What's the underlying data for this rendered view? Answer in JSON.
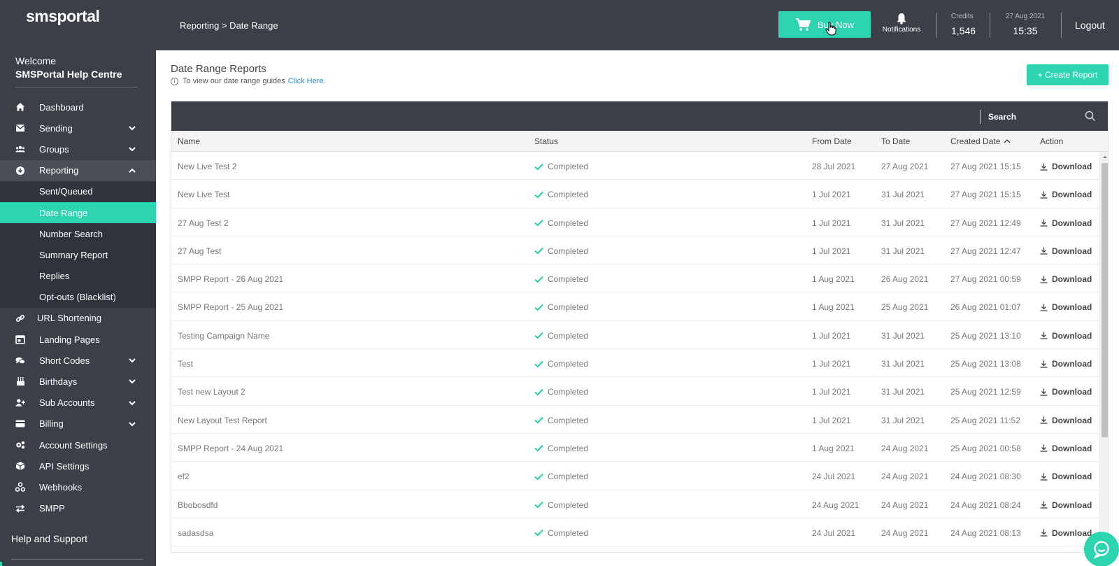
{
  "brand": {
    "logo_text": "smsportal",
    "accent": "#2cd4b0"
  },
  "sidebar": {
    "welcome": "Welcome",
    "org_name": "SMSPortal Help Centre",
    "items": [
      {
        "label": "Dashboard",
        "icon": "home-icon",
        "chevron": false
      },
      {
        "label": "Sending",
        "icon": "envelope-icon",
        "chevron": true
      },
      {
        "label": "Groups",
        "icon": "users-icon",
        "chevron": true
      },
      {
        "label": "Reporting",
        "icon": "download-circle-icon",
        "chevron": true,
        "expanded": true
      }
    ],
    "reporting_sub": [
      {
        "label": "Sent/Queued"
      },
      {
        "label": "Date Range",
        "selected": true
      },
      {
        "label": "Number Search"
      },
      {
        "label": "Summary Report"
      },
      {
        "label": "Replies"
      },
      {
        "label": "Opt-outs (Blacklist)"
      }
    ],
    "items_after": [
      {
        "label": "URL Shortening",
        "icon": "link-icon",
        "chevron": false
      },
      {
        "label": "Landing Pages",
        "icon": "page-icon",
        "chevron": false
      },
      {
        "label": "Short Codes",
        "icon": "chat-bubbles-icon",
        "chevron": true
      },
      {
        "label": "Birthdays",
        "icon": "cake-icon",
        "chevron": true
      },
      {
        "label": "Sub Accounts",
        "icon": "user-plus-icon",
        "chevron": true
      },
      {
        "label": "Billing",
        "icon": "card-icon",
        "chevron": true
      },
      {
        "label": "Account Settings",
        "icon": "gears-icon",
        "chevron": false
      },
      {
        "label": "API Settings",
        "icon": "cube-icon",
        "chevron": false
      },
      {
        "label": "Webhooks",
        "icon": "webhook-icon",
        "chevron": false
      },
      {
        "label": "SMPP",
        "icon": "arrows-icon",
        "chevron": false
      }
    ],
    "help": "Help and Support"
  },
  "topbar": {
    "breadcrumb": "Reporting > Date Range",
    "buy_now": "Buy Now",
    "notifications": "Notifications",
    "credits_label": "Credits",
    "credits_value": "1,546",
    "date": "27 Aug 2021",
    "time": "15:35",
    "logout": "Logout"
  },
  "main": {
    "title": "Date Range Reports",
    "guide_text": "To view our date range guides",
    "guide_link": "Click Here.",
    "create_button": "+ Create Report",
    "search_placeholder": "Search",
    "columns": {
      "name": "Name",
      "status": "Status",
      "from": "From Date",
      "to": "To Date",
      "created": "Created Date",
      "action": "Action"
    },
    "rows": [
      {
        "name": "New Live Test 2",
        "status": "Completed",
        "from": "28 Jul 2021",
        "to": "27 Aug 2021",
        "created": "27 Aug 2021 15:15",
        "action": "Download"
      },
      {
        "name": "New Live Test",
        "status": "Completed",
        "from": "1 Jul 2021",
        "to": "31 Jul 2021",
        "created": "27 Aug 2021 15:15",
        "action": "Download"
      },
      {
        "name": "27 Aug Test 2",
        "status": "Completed",
        "from": "1 Jul 2021",
        "to": "31 Jul 2021",
        "created": "27 Aug 2021 12:49",
        "action": "Download"
      },
      {
        "name": "27 Aug Test",
        "status": "Completed",
        "from": "1 Jul 2021",
        "to": "31 Jul 2021",
        "created": "27 Aug 2021 12:47",
        "action": "Download"
      },
      {
        "name": "SMPP Report - 26 Aug 2021",
        "status": "Completed",
        "from": "1 Aug 2021",
        "to": "26 Aug 2021",
        "created": "27 Aug 2021 00:59",
        "action": "Download"
      },
      {
        "name": "SMPP Report - 25 Aug 2021",
        "status": "Completed",
        "from": "1 Aug 2021",
        "to": "25 Aug 2021",
        "created": "26 Aug 2021 01:07",
        "action": "Download"
      },
      {
        "name": "Testing Campaign Name",
        "status": "Completed",
        "from": "1 Jul 2021",
        "to": "31 Jul 2021",
        "created": "25 Aug 2021 13:10",
        "action": "Download"
      },
      {
        "name": "Test",
        "status": "Completed",
        "from": "1 Jul 2021",
        "to": "31 Jul 2021",
        "created": "25 Aug 2021 13:08",
        "action": "Download"
      },
      {
        "name": "Test new Layout 2",
        "status": "Completed",
        "from": "1 Jul 2021",
        "to": "31 Jul 2021",
        "created": "25 Aug 2021 12:59",
        "action": "Download"
      },
      {
        "name": "New Layout Test Report",
        "status": "Completed",
        "from": "1 Jul 2021",
        "to": "31 Jul 2021",
        "created": "25 Aug 2021 11:52",
        "action": "Download"
      },
      {
        "name": "SMPP Report - 24 Aug 2021",
        "status": "Completed",
        "from": "1 Aug 2021",
        "to": "24 Aug 2021",
        "created": "25 Aug 2021 00:58",
        "action": "Download"
      },
      {
        "name": "ef2",
        "status": "Completed",
        "from": "24 Jul 2021",
        "to": "24 Aug 2021",
        "created": "24 Aug 2021 08:30",
        "action": "Download"
      },
      {
        "name": "Bbobosdfd",
        "status": "Completed",
        "from": "24 Aug 2021",
        "to": "24 Aug 2021",
        "created": "24 Aug 2021 08:24",
        "action": "Download"
      },
      {
        "name": "sadasdsa",
        "status": "Completed",
        "from": "24 Jul 2021",
        "to": "24 Aug 2021",
        "created": "24 Aug 2021 08:13",
        "action": "Download"
      }
    ]
  }
}
